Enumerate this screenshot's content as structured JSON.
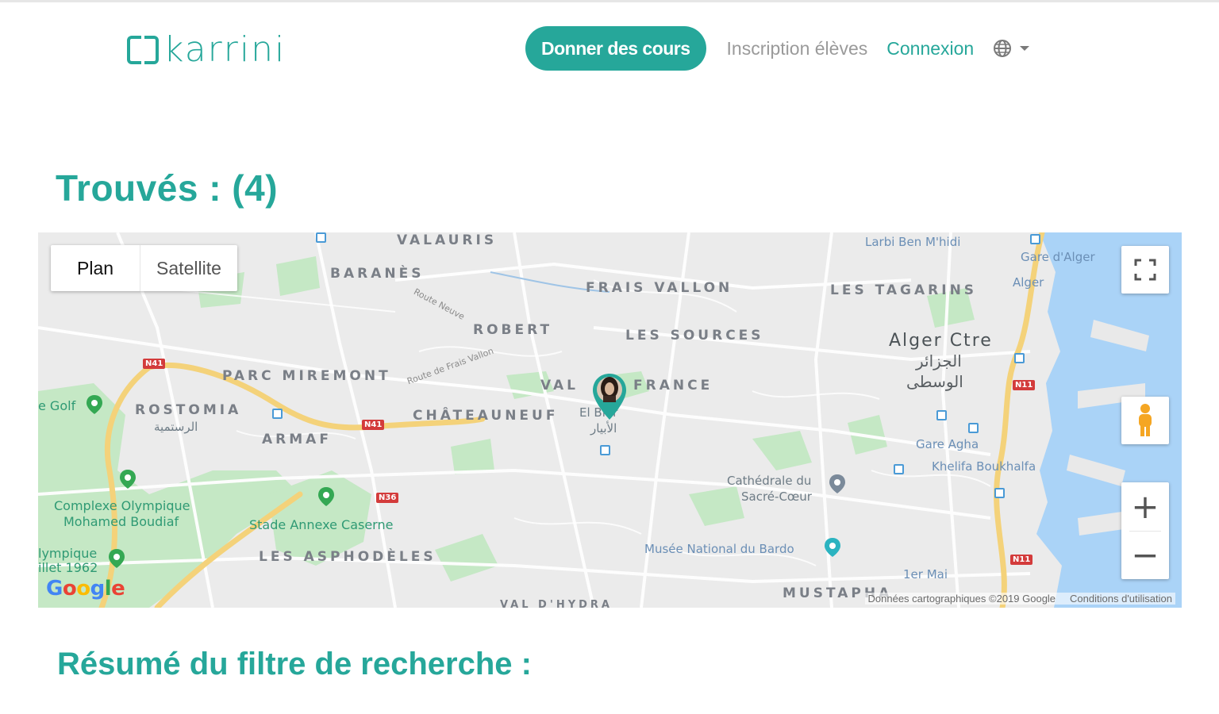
{
  "header": {
    "logo_text": "karrini",
    "nav": {
      "give_courses": "Donner des cours",
      "student_signup": "Inscription élèves",
      "login": "Connexion"
    },
    "language_icon": "globe-icon"
  },
  "results": {
    "found_heading": "Trouvés : (4)",
    "summary_heading": "Résumé du filtre de recherche :"
  },
  "map": {
    "type_buttons": {
      "plan": "Plan",
      "satellite": "Satellite"
    },
    "zoom_in": "+",
    "zoom_out": "−",
    "districts": {
      "valauris": "VALAURIS",
      "baranes": "BARANÈS",
      "frais_vallon": "FRAIS VALLON",
      "les_tagarins": "LES TAGARINS",
      "robert": "ROBERT",
      "les_sources": "LES SOURCES",
      "parc_miremont": "PARC MIREMONT",
      "val_france_left": "VAL",
      "val_france_right": "FRANCE",
      "rostomia": "ROSTOMIA",
      "chateauneuf": "CHÂTEAUNEUF",
      "armaf": "ARMAF",
      "les_asphodeles": "LES ASPHODÈLES",
      "mustapha": "MUSTAPHA",
      "hydra": "VAL D'HYDRA"
    },
    "city": {
      "name": "Alger Ctre",
      "arabic_1": "الجزائر",
      "arabic_2": "الوسطى"
    },
    "el_biar": {
      "latin": "El Biar",
      "arabic": "الأبيار"
    },
    "rostomia_ar": "الرستمية",
    "pois": {
      "larbi": "Larbi Ben M'hidi",
      "gare_alger": "Gare d'Alger",
      "alger": "Alger",
      "gare_agha": "Gare Agha",
      "khelifa": "Khelifa Boukhalfa",
      "cathedrale_1": "Cathédrale du",
      "cathedrale_2": "Sacré-Cœur",
      "bardo": "Musée National du Bardo",
      "premier_mai": "1er Mai",
      "golf": "e Golf",
      "complexe_1": "Complexe Olympique",
      "complexe_2": "Mohamed Boudiaf",
      "olympique_1": "lympique",
      "olympique_2": "illet 1962",
      "stade": "Stade Annexe Caserne"
    },
    "roads": {
      "n41a": "N41",
      "n41b": "N41",
      "n36": "N36",
      "n11a": "N11",
      "n11b": "N11",
      "route_neuve": "Route Neuve",
      "route_frais_vallon": "Route de Frais Vallon"
    },
    "google_logo": "Google",
    "attribution": "Données cartographiques ©2019 Google",
    "terms": "Conditions d'utilisation"
  }
}
